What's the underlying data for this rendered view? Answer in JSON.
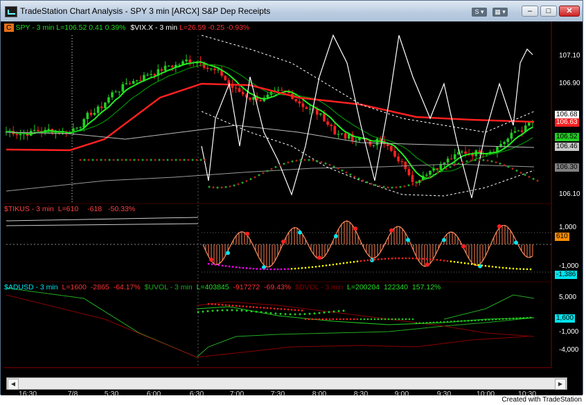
{
  "window": {
    "title": "TradeStation Chart Analysis - SPY 3 min [ARCX] S&P Dep Receipts",
    "toolbar_s_label": "S",
    "toolbar_link_label": "",
    "minimize_label": "–",
    "maximize_label": "□",
    "close_label": "✕"
  },
  "pane1": {
    "badge": "C",
    "symbol_label": "SPY - 3 min",
    "last": "L=106.52",
    "change": "0.41",
    "pct_change": "0.39%",
    "vix_label": "$VIX.X - 3 min",
    "vix_last": "L=26.59",
    "vix_change": "-0.25",
    "vix_pct": "-0.93%",
    "y_ticks": [
      "107.10",
      "106.90",
      "106.10"
    ],
    "price_boxes": [
      {
        "text": "106.68",
        "bg": "#ffffff",
        "fg": "#000000"
      },
      {
        "text": "106.63",
        "bg": "#ff2020",
        "fg": "#ffffff"
      },
      {
        "text": "106.52",
        "bg": "#22cc22",
        "fg": "#000000"
      },
      {
        "text": "106.46",
        "bg": "#c8c8c8",
        "fg": "#000000"
      },
      {
        "text": "106.30",
        "bg": "#808080",
        "fg": "#000000"
      }
    ]
  },
  "pane2": {
    "symbol_label": "$TIKUS - 3 min",
    "last": "L=610",
    "change": "-618",
    "pct": "-50.33%",
    "y_ticks": [
      "1,000",
      "-1,000"
    ],
    "boxes": [
      {
        "text": "610",
        "bg": "#ff8c00",
        "fg": "#000000"
      },
      {
        "text": "-1,386",
        "bg": "#00e5ee",
        "fg": "#000000"
      }
    ]
  },
  "pane3": {
    "adusd_label": "$ADUSD - 3 min",
    "adusd_last": "L=1600",
    "adusd_change": "-2865",
    "adusd_pct": "-64.17%",
    "uvol_label": "$UVOL - 3 min",
    "uvol_last": "L=403845",
    "uvol_change": "-917272",
    "uvol_pct": "-69.43%",
    "dvol_label": "$DVOL - 3 min",
    "dvol_last": "L=200204",
    "dvol_change": "122340",
    "dvol_pct": "157.12%",
    "y_ticks": [
      "5,000",
      "-1,000",
      "-4,000"
    ],
    "box": {
      "text": "1,600",
      "bg": "#00e5ee",
      "fg": "#000000"
    }
  },
  "x_axis": {
    "labels": [
      "16:30",
      "7/8",
      "5:30",
      "6:00",
      "6:30",
      "7:00",
      "7:30",
      "8:00",
      "8:30",
      "9:00",
      "9:30",
      "10:00",
      "10:30"
    ]
  },
  "colors": {
    "up_candle": "#22cc22",
    "down_candle": "#ff2020",
    "background": "#000000",
    "axis_border": "#8b0000"
  },
  "footer": {
    "caption": "Created with TradeStation"
  }
}
